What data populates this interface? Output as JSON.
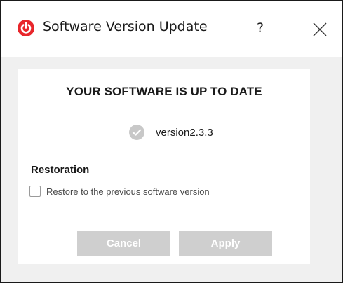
{
  "window": {
    "title": "Software Version Update",
    "help_label": "?",
    "close_icon": "close-icon",
    "app_icon": "power-logo-icon",
    "brand_color": "#e8262b"
  },
  "content": {
    "heading": "YOUR SOFTWARE IS UP TO DATE",
    "status_icon": "check-circle-icon",
    "version": "version2.3.3",
    "restoration_label": "Restoration",
    "restore_option_label": "Restore to the previous software version",
    "restore_checked": false
  },
  "buttons": {
    "cancel_label": "Cancel",
    "apply_label": "Apply",
    "disabled_color": "#cfcfcf"
  }
}
